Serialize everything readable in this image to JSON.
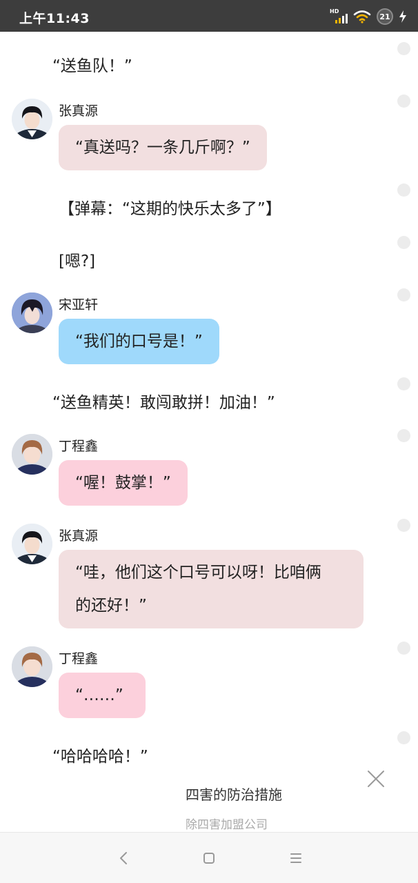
{
  "status_bar": {
    "time": "上午11:43",
    "network_label": "HD",
    "battery": "21",
    "icons": [
      "signal-icon",
      "wifi-icon",
      "battery-icon",
      "charging-icon"
    ]
  },
  "messages": [
    {
      "type": "narration",
      "text": "“送鱼队！”"
    },
    {
      "type": "chat",
      "speaker": "张真源",
      "avatar": "zhang-avatar",
      "bubble_color": "#f2dfe0",
      "text": "“真送吗？一条几斤啊？”"
    },
    {
      "type": "system",
      "text": "【弹幕：“这期的快乐太多了”】"
    },
    {
      "type": "system",
      "text": "[嗯?]"
    },
    {
      "type": "chat",
      "speaker": "宋亚轩",
      "avatar": "song-avatar",
      "bubble_color": "#9fd9fb",
      "text": "“我们的口号是！”"
    },
    {
      "type": "narration",
      "text": "“送鱼精英！敢闯敢拼！加油！”"
    },
    {
      "type": "chat",
      "speaker": "丁程鑫",
      "avatar": "ding-avatar",
      "bubble_color": "#fcd0dc",
      "text": "“喔！鼓掌！”"
    },
    {
      "type": "chat",
      "speaker": "张真源",
      "avatar": "zhang-avatar",
      "bubble_color": "#f2dfe0",
      "text_lines": [
        "“哇，他们这个口号可以呀！比咱俩",
        "的还好！”"
      ]
    },
    {
      "type": "chat",
      "speaker": "丁程鑫",
      "avatar": "ding-avatar",
      "bubble_color": "#fcd0dc",
      "text": "“……”"
    },
    {
      "type": "narration",
      "text": "“哈哈哈哈！”"
    }
  ],
  "ad": {
    "title": "四害的防治措施",
    "subtitle": "除四害加盟公司",
    "close_icon": "close-icon"
  },
  "navbar": {
    "icons": [
      "back-icon",
      "home-icon",
      "menu-icon"
    ]
  }
}
